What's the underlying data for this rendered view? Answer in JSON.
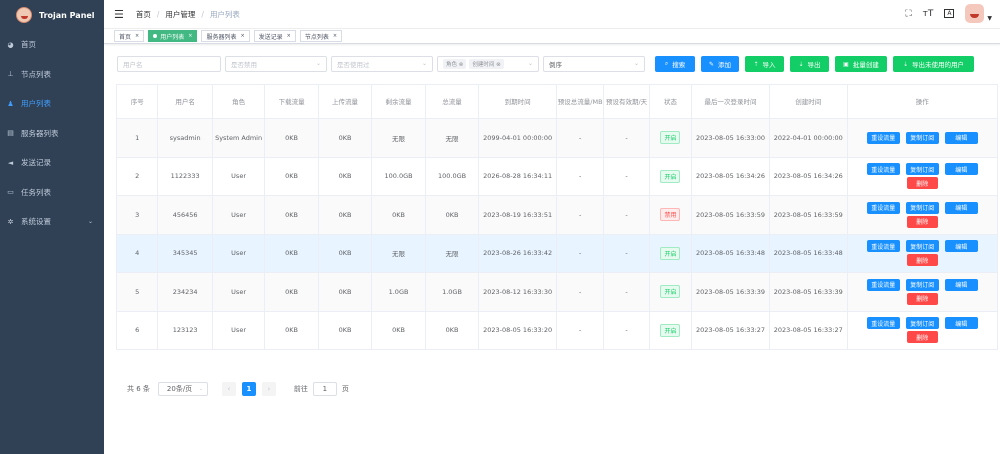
{
  "app": {
    "title": "Trojan Panel"
  },
  "sidebar": {
    "items": [
      {
        "label": "首页",
        "icon": "dashboard-icon"
      },
      {
        "label": "节点列表",
        "icon": "node-icon"
      },
      {
        "label": "用户列表",
        "icon": "user-icon",
        "active": true
      },
      {
        "label": "服务器列表",
        "icon": "server-icon"
      },
      {
        "label": "发送记录",
        "icon": "send-icon"
      },
      {
        "label": "任务列表",
        "icon": "task-icon"
      },
      {
        "label": "系统设置",
        "icon": "gear-icon"
      }
    ]
  },
  "breadcrumb": [
    "首页",
    "用户管理",
    "用户列表"
  ],
  "tags": [
    {
      "label": "首页"
    },
    {
      "label": "用户列表",
      "active": true
    },
    {
      "label": "服务器列表"
    },
    {
      "label": "发送记录"
    },
    {
      "label": "节点列表"
    }
  ],
  "filters": {
    "username_placeholder": "用户名",
    "disabled_placeholder": "是否禁用",
    "expired_placeholder": "是否使用过",
    "role_chip": "角色",
    "time_chip": "创建时间",
    "sort_value": "倒序"
  },
  "buttons": {
    "search": "搜索",
    "add": "添加",
    "import": "导入",
    "export": "导出",
    "batch_create": "批量创建",
    "export_unused": "导出未使用的用户"
  },
  "table": {
    "headers": [
      "序号",
      "用户名",
      "角色",
      "下载流量",
      "上传流量",
      "剩余流量",
      "总流量",
      "到期时间",
      "预设总流量/MB",
      "预设有效期/天",
      "状态",
      "最后一次登录时间",
      "创建时间",
      "操作"
    ],
    "rows": [
      {
        "idx": "1",
        "username": "sysadmin",
        "role": "System Admin",
        "download": "0KB",
        "upload": "0KB",
        "remain": "无限",
        "total": "无限",
        "expire": "2099-04-01 00:00:00",
        "preset_flow": "-",
        "preset_days": "-",
        "status": "开启",
        "last_login": "2023-08-05 16:33:00",
        "created": "2022-04-01 00:00:00"
      },
      {
        "idx": "2",
        "username": "1122333",
        "role": "User",
        "download": "0KB",
        "upload": "0KB",
        "remain": "100.0GB",
        "total": "100.0GB",
        "expire": "2026-08-28 16:34:11",
        "preset_flow": "-",
        "preset_days": "-",
        "status": "开启",
        "last_login": "2023-08-05 16:34:26",
        "created": "2023-08-05 16:34:26"
      },
      {
        "idx": "3",
        "username": "456456",
        "role": "User",
        "download": "0KB",
        "upload": "0KB",
        "remain": "0KB",
        "total": "0KB",
        "expire": "2023-08-19 16:33:51",
        "preset_flow": "-",
        "preset_days": "-",
        "status": "禁用",
        "last_login": "2023-08-05 16:33:59",
        "created": "2023-08-05 16:33:59"
      },
      {
        "idx": "4",
        "username": "345345",
        "role": "User",
        "download": "0KB",
        "upload": "0KB",
        "remain": "无限",
        "total": "无限",
        "expire": "2023-08-26 16:33:42",
        "preset_flow": "-",
        "preset_days": "-",
        "status": "开启",
        "last_login": "2023-08-05 16:33:48",
        "created": "2023-08-05 16:33:48"
      },
      {
        "idx": "5",
        "username": "234234",
        "role": "User",
        "download": "0KB",
        "upload": "0KB",
        "remain": "1.0GB",
        "total": "1.0GB",
        "expire": "2023-08-12 16:33:30",
        "preset_flow": "-",
        "preset_days": "-",
        "status": "开启",
        "last_login": "2023-08-05 16:33:39",
        "created": "2023-08-05 16:33:39"
      },
      {
        "idx": "6",
        "username": "123123",
        "role": "User",
        "download": "0KB",
        "upload": "0KB",
        "remain": "0KB",
        "total": "0KB",
        "expire": "2023-08-05 16:33:20",
        "preset_flow": "-",
        "preset_days": "-",
        "status": "开启",
        "last_login": "2023-08-05 16:33:27",
        "created": "2023-08-05 16:33:27"
      }
    ],
    "actions": {
      "reset": "重设流量",
      "copy": "复制订阅",
      "edit": "编辑",
      "delete": "删除"
    }
  },
  "pagination": {
    "total": "共 6 条",
    "page_size": "20条/页",
    "current": "1",
    "goto_label": "前往",
    "goto_value": "1",
    "page_suffix": "页"
  },
  "colors": {
    "sidebar_bg": "#304156",
    "primary": "#1890ff",
    "success": "#13ce66",
    "danger": "#ff4949",
    "tag_active": "#42b983"
  }
}
